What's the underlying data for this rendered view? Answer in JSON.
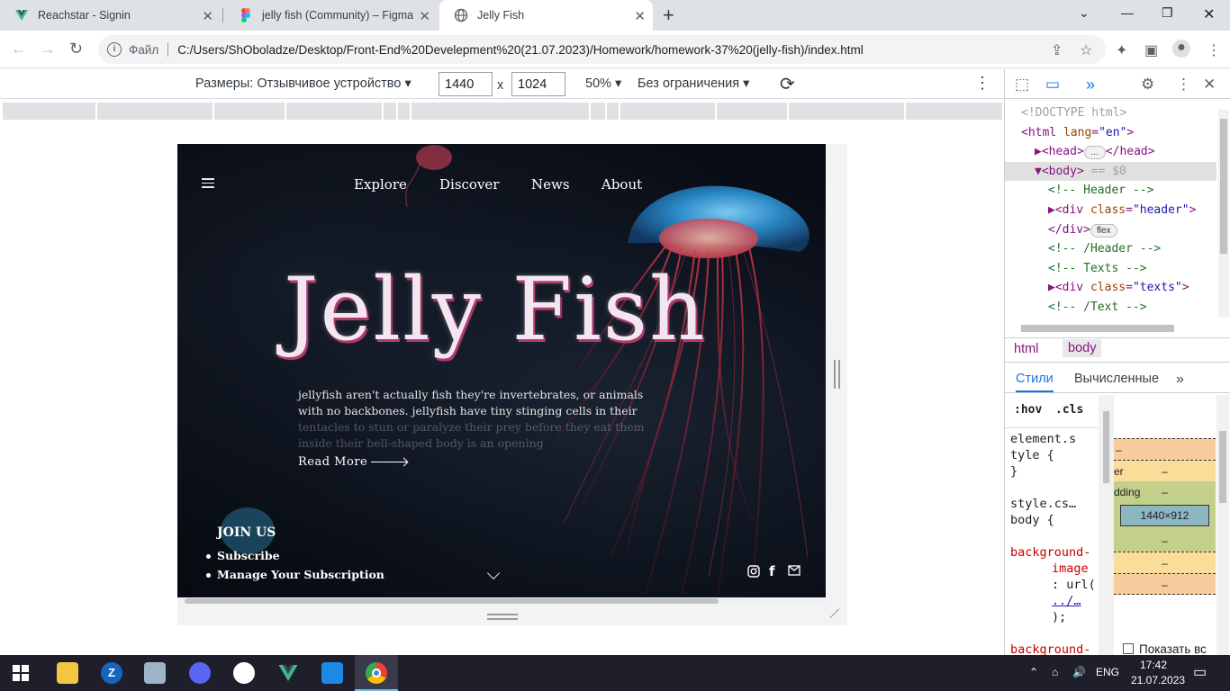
{
  "tabs": [
    {
      "title": "Reachstar - Signin",
      "icon": "vue-icon"
    },
    {
      "title": "jelly fish (Community) – Figma",
      "icon": "figma-icon"
    },
    {
      "title": "Jelly Fish",
      "icon": "globe-icon"
    }
  ],
  "address": {
    "scheme_label": "Файл",
    "url": "C:/Users/ShOboladze/Desktop/Front-End%20Develepment%20(21.07.2023)/Homework/homework-37%20(jelly-fish)/index.html"
  },
  "device_toolbar": {
    "dimensions_label": "Размеры: Отзывчивое устройство",
    "width": "1440",
    "times": "x",
    "height": "1024",
    "zoom": "50%",
    "throttle": "Без ограничения"
  },
  "page": {
    "nav": [
      "Explore",
      "Discover",
      "News",
      "About"
    ],
    "title": "Jelly Fish",
    "description": "jellyfish aren't actually fish they're invertebrates, or animals with no backbones. jellyfish have tiny stinging cells in their",
    "description_faded": "tentacles to stun or paralyze their prey before they eat them inside their bell-shaped body is an opening",
    "read_more": "Read More",
    "join_title": "JOIN US",
    "join_links": [
      "Subscribe",
      "Manage Your Subscription"
    ],
    "social": [
      "instagram-icon",
      "facebook-icon",
      "mail-icon"
    ]
  },
  "devtools": {
    "code": [
      {
        "indent": 0,
        "parts": [
          [
            "c-gray",
            "<!DOCTYPE html>"
          ]
        ]
      },
      {
        "indent": 0,
        "parts": [
          [
            "c-tag",
            "<html "
          ],
          [
            "c-attr",
            "lang"
          ],
          [
            "c-tag",
            "="
          ],
          [
            "c-val",
            "\"en\""
          ],
          [
            "c-tag",
            ">"
          ]
        ]
      },
      {
        "indent": 1,
        "parts": [
          [
            "c-tag",
            "▶<head>"
          ],
          [
            "pill",
            "…"
          ],
          [
            "c-tag",
            "</head>"
          ]
        ]
      },
      {
        "indent": 1,
        "parts": [
          [
            "c-tag",
            "▼<body>"
          ],
          [
            "c-gray",
            " == $0"
          ]
        ],
        "selected": true
      },
      {
        "indent": 2,
        "parts": [
          [
            "c-com",
            "<!-- Header -->"
          ]
        ]
      },
      {
        "indent": 2,
        "parts": [
          [
            "c-tag",
            "▶<div "
          ],
          [
            "c-attr",
            "class"
          ],
          [
            "c-tag",
            "="
          ],
          [
            "c-val",
            "\"header\""
          ],
          [
            "c-tag",
            ">"
          ]
        ]
      },
      {
        "indent": 2,
        "parts": [
          [
            "c-tag",
            "</div>"
          ],
          [
            "pill",
            "flex"
          ]
        ]
      },
      {
        "indent": 2,
        "parts": [
          [
            "c-com",
            "<!-- /Header -->"
          ]
        ]
      },
      {
        "indent": 2,
        "parts": [
          [
            "c-com",
            "<!-- Texts -->"
          ]
        ]
      },
      {
        "indent": 2,
        "parts": [
          [
            "c-tag",
            "▶<div "
          ],
          [
            "c-attr",
            "class"
          ],
          [
            "c-tag",
            "="
          ],
          [
            "c-val",
            "\"texts\""
          ],
          [
            "c-tag",
            ">"
          ]
        ]
      },
      {
        "indent": 2,
        "parts": [
          [
            "c-com",
            "<!-- /Text -->"
          ]
        ]
      }
    ],
    "breadcrumbs": [
      "html",
      "body"
    ],
    "style_tabs": [
      "Стили",
      "Вычисленные"
    ],
    "filters": [
      ":hov",
      ".cls"
    ],
    "styles_lines": [
      "element.s",
      "tyle {",
      "}",
      "",
      "style.cs…",
      "body {",
      "",
      "background-",
      "image",
      ": url(",
      "../…",
      ");",
      "",
      "background-"
    ],
    "box_dims": "1440×912",
    "box_labels": [
      "–",
      "er",
      "–",
      "dding",
      "–",
      "–",
      "–",
      "–"
    ],
    "show_all": "Показать вс"
  },
  "tray": {
    "lang": "ENG",
    "time": "17:42",
    "date": "21.07.2023"
  }
}
